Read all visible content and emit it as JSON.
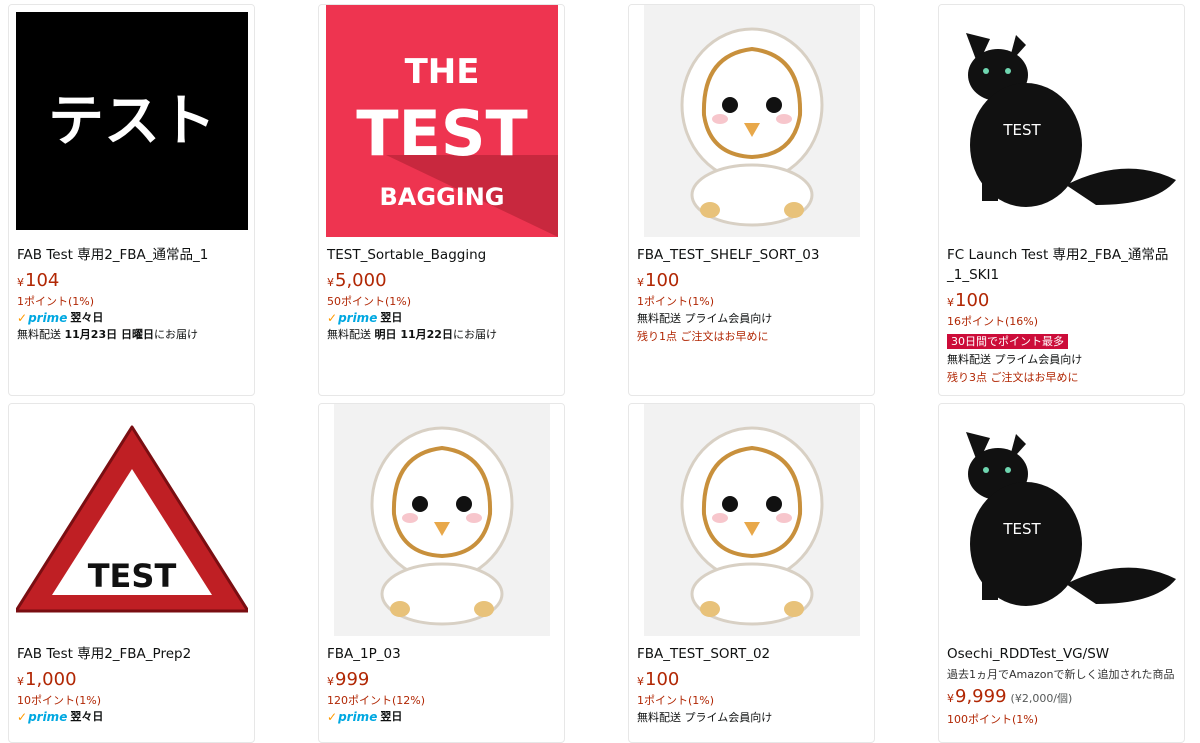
{
  "products": [
    {
      "title": "FAB Test 専用2_FBA_通常品_1",
      "image_text": "テスト",
      "price": "104",
      "points": "1ポイント(1%)",
      "prime_day": "翌々日",
      "delivery_prefix": "無料配送 ",
      "delivery_date": "11月23日 日曜日",
      "delivery_suffix": "にお届け"
    },
    {
      "title": "TEST_Sortable_Bagging",
      "image_text_1": "THE",
      "image_text_2": "TEST",
      "image_text_3": "BAGGING",
      "price": "5,000",
      "points": "50ポイント(1%)",
      "prime_day": "翌日",
      "delivery_prefix": "無料配送 ",
      "delivery_date": "明日 11月22日",
      "delivery_suffix": "にお届け"
    },
    {
      "title": "FBA_TEST_SHELF_SORT_03",
      "price": "100",
      "points": "1ポイント(1%)",
      "shipping": "無料配送 プライム会員向け",
      "stock": "残り1点 ご注文はお早めに"
    },
    {
      "title": "FC Launch Test 専用2_FBA_通常品_1_SKI1",
      "image_text": "TEST",
      "price": "100",
      "points": "16ポイント(16%)",
      "badge": "30日間でポイント最多",
      "shipping": "無料配送 プライム会員向け",
      "stock": "残り3点 ご注文はお早めに"
    },
    {
      "title": "FAB Test 専用2_FBA_Prep2",
      "image_text": "TEST",
      "price": "1,000",
      "points": "10ポイント(1%)",
      "prime_day": "翌々日"
    },
    {
      "title": "FBA_1P_03",
      "price": "999",
      "points": "120ポイント(12%)",
      "prime_day": "翌日"
    },
    {
      "title": "FBA_TEST_SORT_02",
      "price": "100",
      "points": "1ポイント(1%)",
      "shipping": "無料配送 プライム会員向け"
    },
    {
      "title": "Osechi_RDDTest_VG/SW",
      "note": "過去1ヵ月でAmazonで新しく追加された商品",
      "image_text": "TEST",
      "price": "9,999",
      "unit_price": "(¥2,000/個)",
      "points": "100ポイント(1%)"
    }
  ],
  "currency": "¥",
  "prime_label": "prime",
  "colors": {
    "price": "#b12704",
    "badge": "#cc0c39",
    "prime": "#00a8e1",
    "check": "#ff9900"
  }
}
